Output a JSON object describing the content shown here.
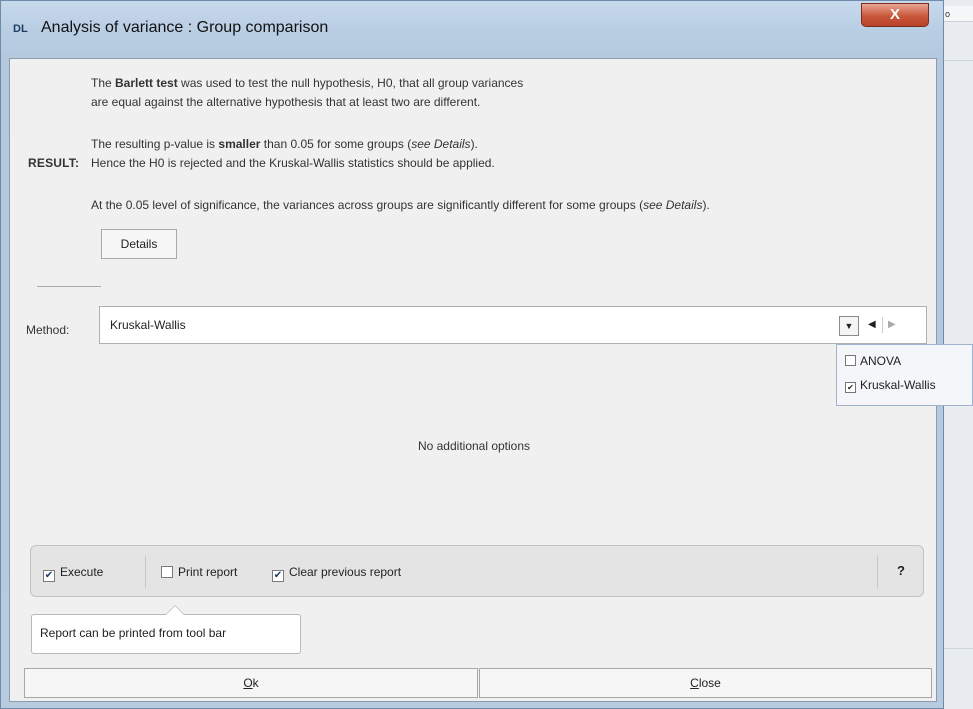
{
  "window": {
    "title": "Analysis of variance : Group comparison",
    "close_glyph": "X",
    "app_icon": "DL"
  },
  "background": {
    "tab_text": "o"
  },
  "info": {
    "line1_pre": "The ",
    "line1_bold": "Barlett test",
    "line1_post": " was used to test the null hypothesis, H0, that all group variances",
    "line2": "are equal against the alternative hypothesis that at least two are different.",
    "line3_pre": "The resulting p-value is ",
    "line3_bold": "smaller",
    "line3_post": " than 0.05 for some groups (",
    "line3_em": "see Details",
    "line3_end": ").",
    "result_label": "RESULT:",
    "line4": "Hence the H0 is rejected and the Kruskal-Wallis statistics should be applied.",
    "line5_pre": "At the 0.05 level of significance, the variances across groups are significantly different for some groups (",
    "line5_em": "see Details",
    "line5_end": ").",
    "details_button": "Details"
  },
  "method": {
    "label": "Method:",
    "value": "Kruskal-Wallis",
    "dropdown_icon": "chevron-down-icon",
    "options": [
      {
        "label": "ANOVA",
        "checked": false
      },
      {
        "label": "Kruskal-Wallis",
        "checked": true
      }
    ]
  },
  "no_options_text": "No additional options",
  "toolbar": {
    "execute_label": "Execute",
    "execute_checked": true,
    "print_label": "Print report",
    "print_checked": false,
    "clear_label": "Clear previous report",
    "clear_checked": true,
    "help_label": "?"
  },
  "tooltip": "Report can be printed from tool bar",
  "footer": {
    "ok_mnemonic": "O",
    "ok_rest": "k",
    "close_mnemonic": "C",
    "close_rest": "lose"
  }
}
